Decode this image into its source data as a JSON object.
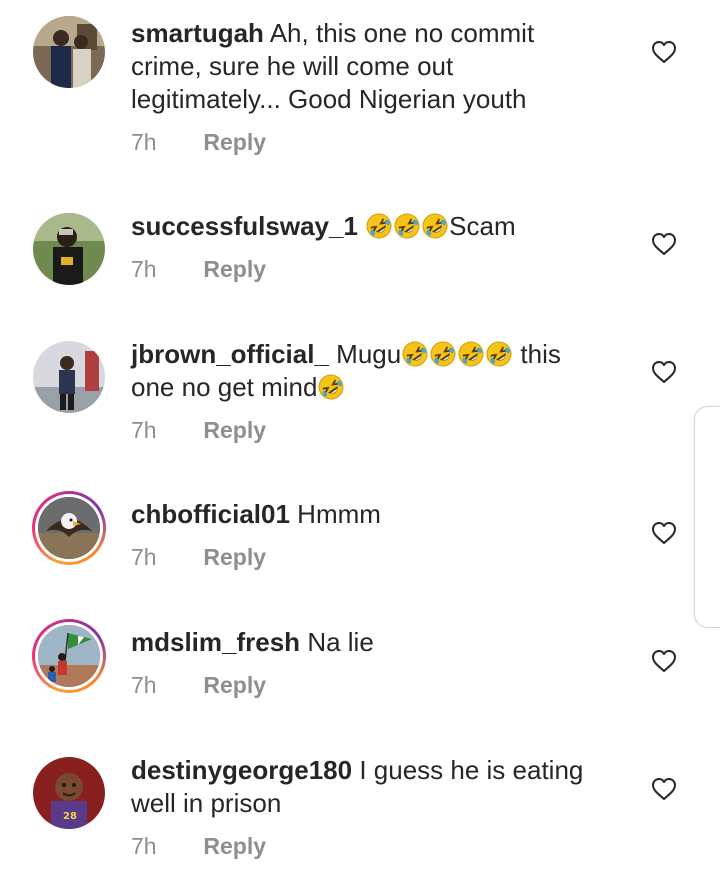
{
  "comments": [
    {
      "username": "smartugah",
      "text": "Ah, this one no commit crime,  sure he will come out legitimately... Good Nigerian youth",
      "emojis_after": 0,
      "time": "7h",
      "reply_label": "Reply"
    },
    {
      "username": "successfulsway_1",
      "text_before": "",
      "emojis": 3,
      "text": "Scam",
      "time": "7h",
      "reply_label": "Reply"
    },
    {
      "username": "jbrown_official_",
      "text_a": "Mugu",
      "emojis_a": 4,
      "text_b": " this one no get mind",
      "emojis_b": 1,
      "time": "7h",
      "reply_label": "Reply"
    },
    {
      "username": "chbofficial01",
      "text": "Hmmm",
      "time": "7h",
      "reply_label": "Reply"
    },
    {
      "username": "mdslim_fresh",
      "text": "Na lie",
      "time": "7h",
      "reply_label": "Reply"
    },
    {
      "username": "destinygeorge180",
      "text": "I guess he is eating well in prison",
      "time": "7h",
      "reply_label": "Reply"
    }
  ],
  "icons": {
    "like": "heart-outline-icon",
    "emoji": "rolling-on-floor-laughing-emoji"
  },
  "colors": {
    "text": "#262626",
    "secondary": "#8e8e8e",
    "story_ring": "#ee2a7b"
  }
}
